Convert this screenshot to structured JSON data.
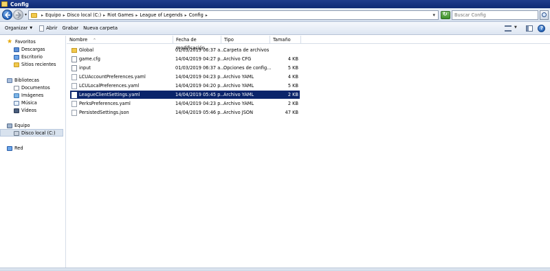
{
  "window": {
    "title": "Config"
  },
  "address": {
    "crumbs": [
      "Equipo",
      "Disco local (C:)",
      "Riot Games",
      "League of Legends",
      "Config"
    ]
  },
  "search": {
    "placeholder": "Buscar Config"
  },
  "toolbar": {
    "organize": "Organizar",
    "open": "Abrir",
    "burn": "Grabar",
    "new_folder": "Nueva carpeta"
  },
  "nav": {
    "favorites": {
      "label": "Favoritos",
      "items": [
        "Descargas",
        "Escritorio",
        "Sitios recientes"
      ]
    },
    "libraries": {
      "label": "Bibliotecas",
      "items": [
        "Documentos",
        "Imágenes",
        "Música",
        "Vídeos"
      ]
    },
    "computer": {
      "label": "Equipo",
      "items": [
        "Disco local (C:)"
      ]
    },
    "network": {
      "label": "Red"
    }
  },
  "columns": {
    "name": "Nombre",
    "date": "Fecha de modificación",
    "type": "Tipo",
    "size": "Tamaño"
  },
  "files": [
    {
      "name": "Global",
      "date": "01/03/2019 06:37 a...",
      "type": "Carpeta de archivos",
      "size": "",
      "icon": "folder-icon"
    },
    {
      "name": "game.cfg",
      "date": "14/04/2019 04:27 p...",
      "type": "Archivo CFG",
      "size": "4 KB",
      "icon": "cfg-file-icon"
    },
    {
      "name": "input",
      "date": "01/03/2019 06:37 a...",
      "type": "Opciones de config...",
      "size": "5 KB",
      "icon": "config-file-icon"
    },
    {
      "name": "LCUAccountPreferences.yaml",
      "date": "14/04/2019 04:23 p...",
      "type": "Archivo YAML",
      "size": "4 KB",
      "icon": "file-icon"
    },
    {
      "name": "LCULocalPreferences.yaml",
      "date": "14/04/2019 04:20 p...",
      "type": "Archivo YAML",
      "size": "5 KB",
      "icon": "file-icon"
    },
    {
      "name": "LeagueClientSettings.yaml",
      "date": "14/04/2019 05:45 p...",
      "type": "Archivo YAML",
      "size": "2 KB",
      "icon": "file-icon",
      "selected": true
    },
    {
      "name": "PerksPreferences.yaml",
      "date": "14/04/2019 04:23 p...",
      "type": "Archivo YAML",
      "size": "2 KB",
      "icon": "file-icon"
    },
    {
      "name": "PersistedSettings.json",
      "date": "14/04/2019 05:46 p...",
      "type": "Archivo JSON",
      "size": "47 KB",
      "icon": "file-icon"
    }
  ],
  "colors": {
    "title_bar": "#1f3c8c",
    "selection": "#0a246a",
    "nav_selection": "#d8e2ee"
  }
}
